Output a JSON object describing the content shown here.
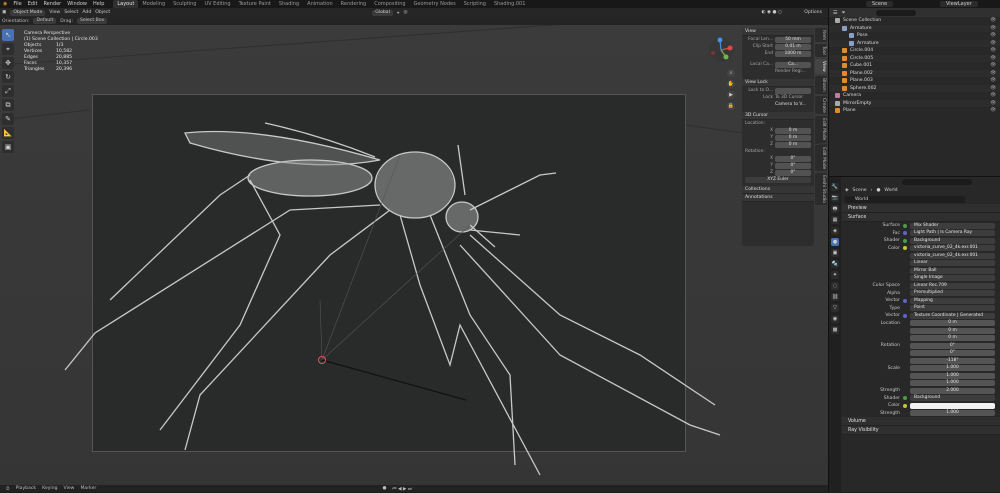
{
  "menu": [
    "File",
    "Edit",
    "Render",
    "Window",
    "Help"
  ],
  "workspaces": [
    "Layout",
    "Modeling",
    "Sculpting",
    "UV Editing",
    "Texture Paint",
    "Shading",
    "Animation",
    "Rendering",
    "Compositing",
    "Geometry Nodes",
    "Scripting",
    "Shading.001"
  ],
  "active_workspace": "Layout",
  "scene": "Scene",
  "view_layer": "ViewLayer",
  "viewport_header": {
    "mode": "Object Mode",
    "items": [
      "View",
      "Select",
      "Add",
      "Object"
    ],
    "transform": "Global",
    "options": "Options"
  },
  "viewport_header2": {
    "orientation_label": "Orientation:",
    "orientation": "Default",
    "drag_label": "Drag:",
    "drag": "Select Box"
  },
  "viewport_info": {
    "line1": "Camera Perspective",
    "line2": "(1) Scene Collection | Circle.003",
    "stats": [
      [
        "Objects",
        "1/3"
      ],
      [
        "Vertices",
        "10,582"
      ],
      [
        "Edges",
        "20,885"
      ],
      [
        "Faces",
        "10,357"
      ],
      [
        "Triangles",
        "20,396"
      ]
    ]
  },
  "npanel_tabs": [
    "Item",
    "Tool",
    "View",
    "Blosm",
    "Create",
    "Edit Mode",
    "Edit Mode",
    "Eeshi Studio"
  ],
  "npanel": {
    "view_title": "View",
    "focal_label": "Focal Len...",
    "focal": "50 mm",
    "clip_start_label": "Clip Start",
    "clip_start": "0.01 m",
    "end_label": "End",
    "end": "1000 m",
    "local_label": "Local Ca...",
    "local": "Ca...",
    "render_region": "Render Regi...",
    "view_lock_title": "View Lock",
    "lock_to_label": "Lock to O...",
    "lock_label": "Lock",
    "to_3d_cursor": "To 3D Cursor",
    "camera_to_view": "Camera to V...",
    "cursor_title": "3D Cursor",
    "location_label": "Location:",
    "x": "0 m",
    "y": "0 m",
    "z": "0 m",
    "rotation_label": "Rotation:",
    "rx": "0°",
    "ry": "0°",
    "rz": "0°",
    "rot_mode": "XYZ Euler",
    "collections": "Collections",
    "annotations": "Annotations"
  },
  "bottom_bar": [
    "Playback",
    "Keying",
    "View",
    "Marker"
  ],
  "outliner": {
    "search_placeholder": "",
    "items": [
      {
        "name": "Scene Collection",
        "indent": 0,
        "color": "#aaaaaa"
      },
      {
        "name": "Armature",
        "indent": 1,
        "color": "#8aa0c8"
      },
      {
        "name": "Pose",
        "indent": 2,
        "color": "#8aa0c8"
      },
      {
        "name": "Armature",
        "indent": 2,
        "color": "#8aa0c8"
      },
      {
        "name": "Circle.004",
        "indent": 1,
        "color": "#e38a30"
      },
      {
        "name": "Circle.005",
        "indent": 1,
        "color": "#e38a30"
      },
      {
        "name": "Cube.001",
        "indent": 1,
        "color": "#e38a30"
      },
      {
        "name": "Plane.002",
        "indent": 1,
        "color": "#e38a30"
      },
      {
        "name": "Plane.003",
        "indent": 1,
        "color": "#e38a30"
      },
      {
        "name": "Sphere.002",
        "indent": 1,
        "color": "#e38a30"
      },
      {
        "name": "Camera",
        "indent": 0,
        "color": "#c07ba5"
      },
      {
        "name": "MirrorEmpty",
        "indent": 0,
        "color": "#aaaaaa"
      },
      {
        "name": "Plane",
        "indent": 0,
        "color": "#e38a30"
      }
    ]
  },
  "properties": {
    "crumb_scene": "Scene",
    "crumb_world": "World",
    "world_name": "World",
    "preview": "Preview",
    "surface": "Surface",
    "rows": [
      {
        "label": "Surface",
        "value": "Mix Shader",
        "dot": "g"
      },
      {
        "label": "Fac",
        "value": "Light Path | Is Camera Ray",
        "dot": "p"
      },
      {
        "label": "Shader",
        "value": "Background",
        "dot": "g"
      },
      {
        "label": "Color",
        "value": "victoria_curve_02_4k.exr.001",
        "dot": "y"
      },
      {
        "label": "",
        "value": "victoria_curve_02_4k.exr.001",
        "dot": ""
      },
      {
        "label": "",
        "value": "Linear",
        "dot": ""
      },
      {
        "label": "",
        "value": "Mirror Ball",
        "dot": ""
      },
      {
        "label": "",
        "value": "Single Image",
        "dot": ""
      },
      {
        "label": "Color Space",
        "value": "Linear Rec.709",
        "dot": ""
      },
      {
        "label": "Alpha",
        "value": "Premultiplied",
        "dot": ""
      },
      {
        "label": "Vector",
        "value": "Mapping",
        "dot": "p"
      },
      {
        "label": "Type",
        "value": "Point",
        "dot": ""
      },
      {
        "label": "Vector",
        "value": "Texture Coordinate | Generated",
        "dot": "p"
      },
      {
        "label": "Location",
        "value": "0 m",
        "dot": "",
        "num": true
      },
      {
        "label": "",
        "value": "0 m",
        "dot": "",
        "num": true
      },
      {
        "label": "",
        "value": "0 m",
        "dot": "",
        "num": true
      },
      {
        "label": "Rotation",
        "value": "0°",
        "dot": "",
        "num": true
      },
      {
        "label": "",
        "value": "0°",
        "dot": "",
        "num": true
      },
      {
        "label": "",
        "value": "-118°",
        "dot": "",
        "num": true
      },
      {
        "label": "Scale",
        "value": "1.000",
        "dot": "",
        "num": true
      },
      {
        "label": "",
        "value": "1.000",
        "dot": "",
        "num": true
      },
      {
        "label": "",
        "value": "1.000",
        "dot": "",
        "num": true
      },
      {
        "label": "Strength",
        "value": "2.000",
        "dot": "",
        "num": true
      },
      {
        "label": "Shader",
        "value": "Background",
        "dot": "g"
      },
      {
        "label": "Color",
        "value": "",
        "dot": "y"
      },
      {
        "label": "Strength",
        "value": "1.000",
        "dot": "",
        "num": true
      }
    ],
    "volume": "Volume",
    "ray_visibility": "Ray Visibility"
  },
  "colors": {
    "accent": "#4772b3",
    "orange": "#e38a30"
  }
}
